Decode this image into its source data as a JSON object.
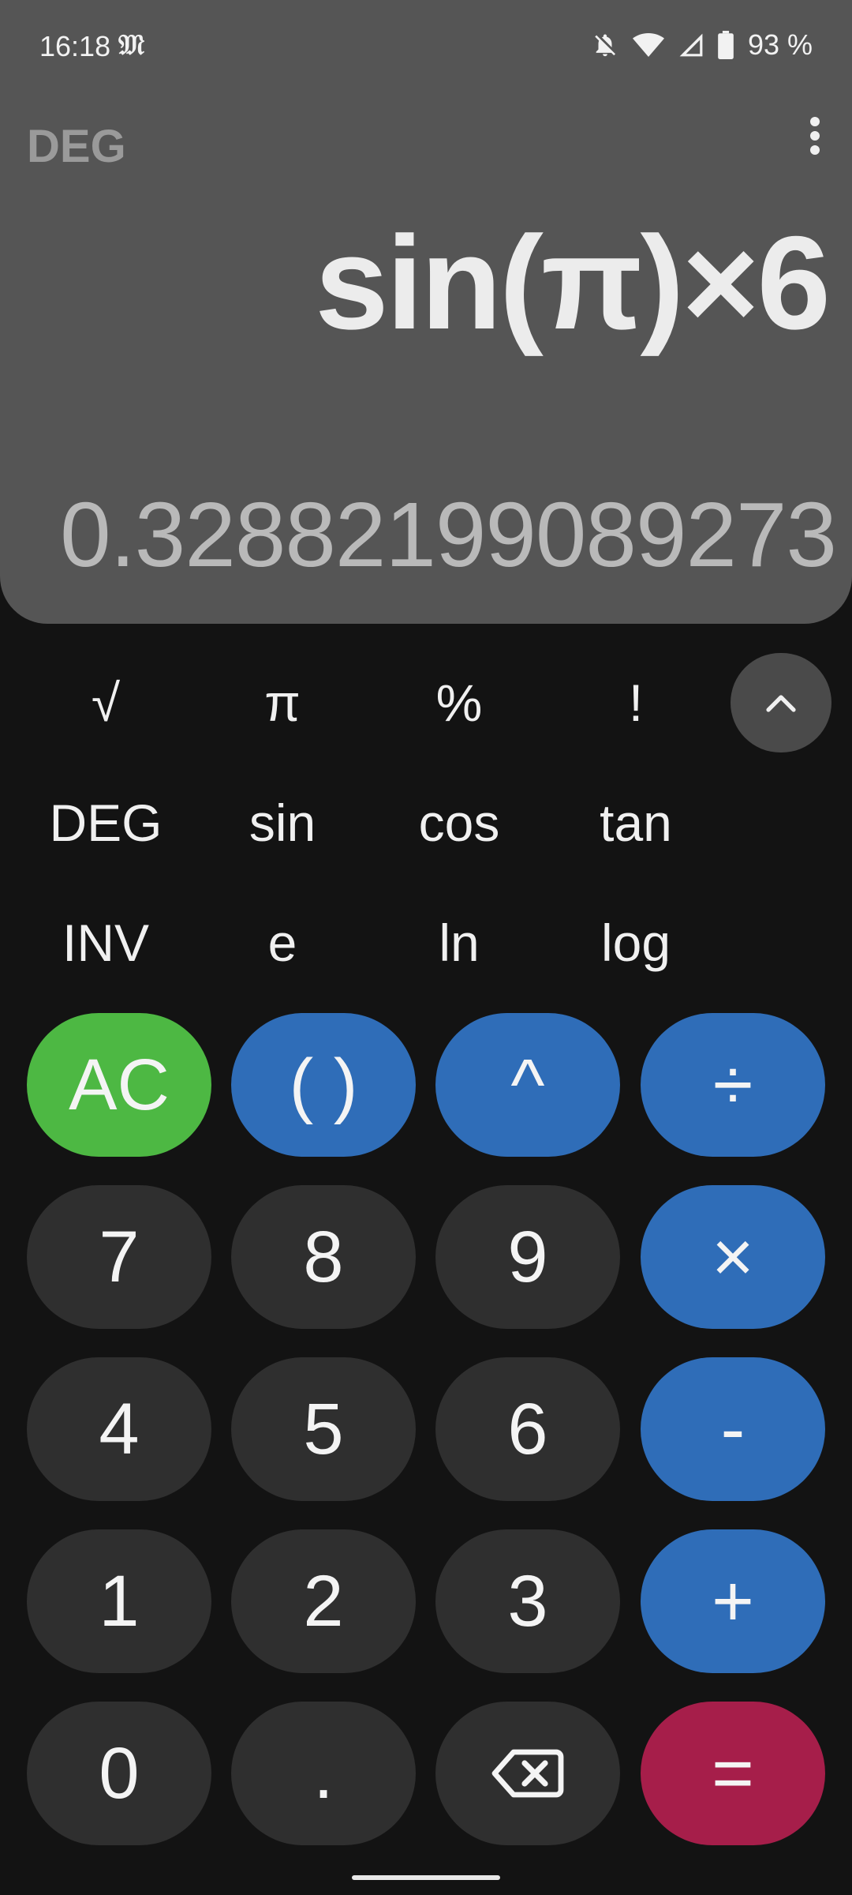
{
  "status_bar": {
    "time": "16:18",
    "app_badge": "𝔐",
    "battery": "93 %",
    "icons": [
      "bell-off-icon",
      "wifi-icon",
      "cell-signal-icon",
      "battery-icon"
    ]
  },
  "display": {
    "angle_mode": "DEG",
    "expression": "sin(π)×6",
    "result": "0.32882199089273"
  },
  "scientific": {
    "row1": [
      "√",
      "π",
      "%",
      "!"
    ],
    "row2": [
      "DEG",
      "sin",
      "cos",
      "tan"
    ],
    "row3": [
      "INV",
      "e",
      "ln",
      "log"
    ]
  },
  "keypad": {
    "row1": [
      "AC",
      "( )",
      "^",
      "÷"
    ],
    "row2": [
      "7",
      "8",
      "9",
      "×"
    ],
    "row3": [
      "4",
      "5",
      "6",
      "-"
    ],
    "row4": [
      "1",
      "2",
      "3",
      "+"
    ],
    "row5": [
      "0",
      ".",
      "backspace",
      "="
    ]
  },
  "colors": {
    "display_bg": "#555555",
    "app_bg": "#131313",
    "number_key": "#2f2f2f",
    "operator_key": "#2f6db8",
    "clear_key": "#4db843",
    "equals_key": "#a61e4a"
  }
}
